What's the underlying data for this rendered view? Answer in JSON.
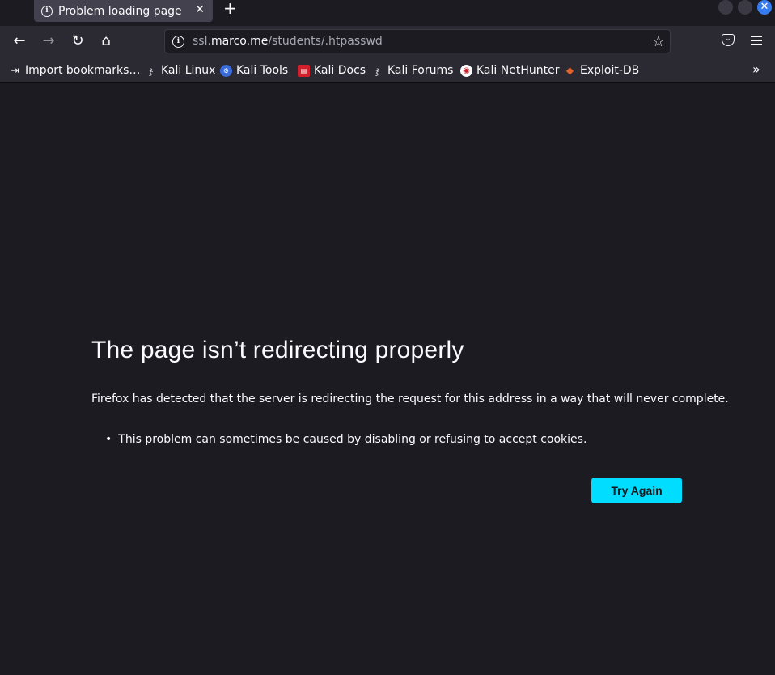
{
  "tabstrip": {
    "active_tab_title": "Problem loading page",
    "close_symbol": "✕",
    "new_tab_symbol": "+",
    "window_close_symbol": "✕"
  },
  "navbar": {
    "back_symbol": "←",
    "forward_symbol": "→",
    "reload_symbol": "↻",
    "home_symbol": "⌂",
    "url_prefix": "ssl.",
    "url_host": "marco.me",
    "url_path": "/students/.htpasswd",
    "star_symbol": "☆"
  },
  "bookmarks": {
    "items": [
      {
        "label": "Import bookmarks…",
        "icon": "import-icon"
      },
      {
        "label": "Kali Linux",
        "icon": "kali-dragon-icon"
      },
      {
        "label": "Kali Tools",
        "icon": "kali-tools-icon"
      },
      {
        "label": "Kali Docs",
        "icon": "kali-docs-icon"
      },
      {
        "label": "Kali Forums",
        "icon": "kali-forums-icon"
      },
      {
        "label": "Kali NetHunter",
        "icon": "nethunter-icon"
      },
      {
        "label": "Exploit-DB",
        "icon": "exploit-db-icon"
      }
    ],
    "overflow_symbol": "»"
  },
  "error": {
    "title": "The page isn’t redirecting properly",
    "description": "Firefox has detected that the server is redirecting the request for this address in a way that will never complete.",
    "bullets": [
      "This problem can sometimes be caused by disabling or refusing to accept cookies."
    ],
    "button_label": "Try Again"
  },
  "colors": {
    "background": "#1c1b22",
    "toolbar": "#2b2a33",
    "accent_button": "#00ddff",
    "window_close": "#367bf0"
  }
}
